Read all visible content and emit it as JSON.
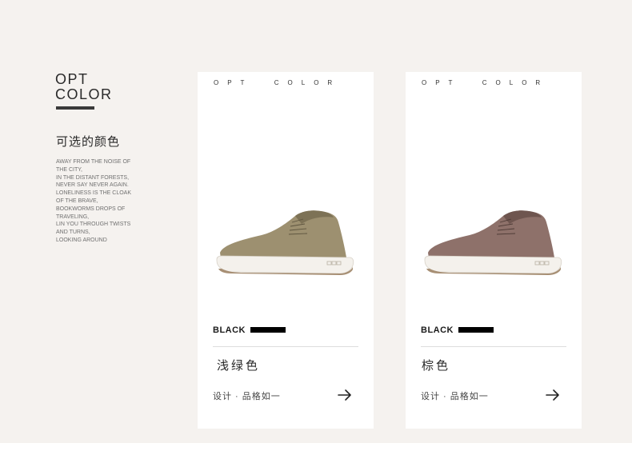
{
  "header": {
    "title_line1": "OPT",
    "title_line2": "COLOR",
    "heading_cn": "可选的颜色",
    "blurb_lines": [
      "AWAY FROM THE NOISE OF",
      "THE CITY,",
      "IN THE DISTANT FORESTS,",
      "NEVER SAY NEVER AGAIN.",
      "LONELINESS IS THE CLOAK",
      "OF THE BRAVE,",
      "BOOKWORMS DROPS OF",
      "TRAVELING,",
      "LIN YOU THROUGH TWISTS",
      "AND TURNS,",
      "LOOKING AROUND"
    ]
  },
  "cards": [
    {
      "caption": "OPT  COLOR",
      "color_label": "BLACK",
      "name_cn": "浅绿色",
      "tagline": "设计 · 品格如一",
      "shoe_colors": {
        "upper": "#9d9070",
        "upper_dark": "#7d7256",
        "sole": "#f4f1ec",
        "stripe": "#a78f74"
      },
      "arrow_icon": "arrow-right-icon"
    },
    {
      "caption": "OPT  COLOR",
      "color_label": "BLACK",
      "name_cn": "棕色",
      "tagline": "设计 · 品格如一",
      "shoe_colors": {
        "upper": "#8e716a",
        "upper_dark": "#6e554f",
        "sole": "#f4f1ec",
        "stripe": "#a78f74"
      },
      "arrow_icon": "arrow-right-icon"
    }
  ],
  "colors": {
    "background": "#f5f2ef",
    "card": "#ffffff",
    "text": "#2a2a2a",
    "swatch": "#000000"
  }
}
